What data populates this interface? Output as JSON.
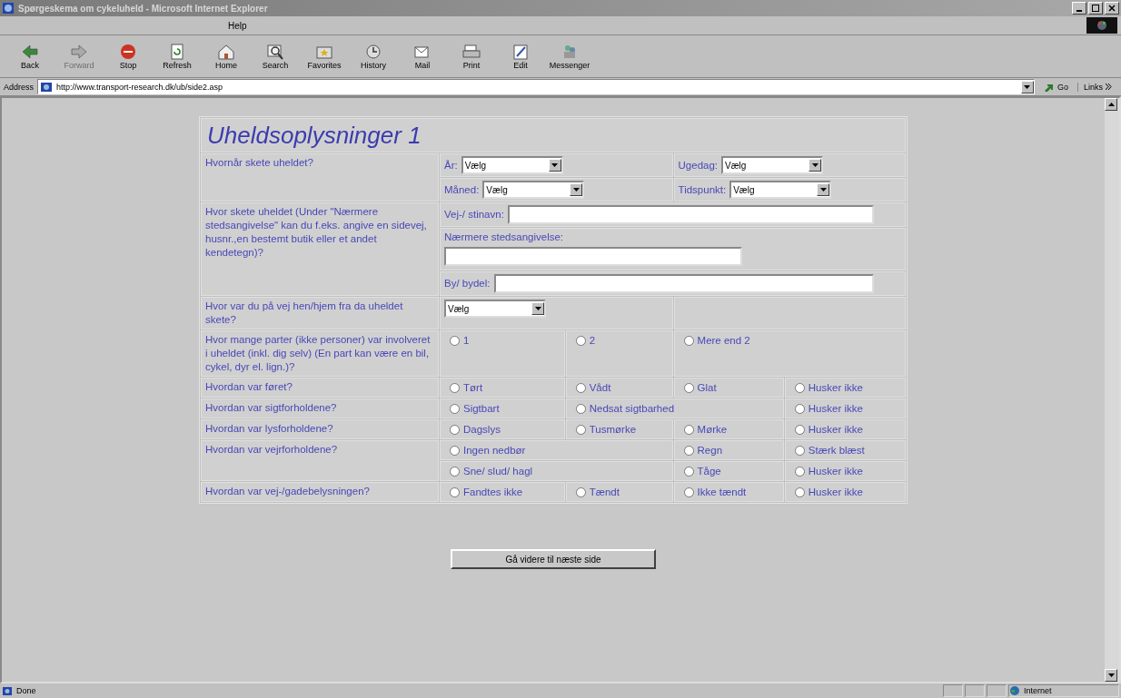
{
  "window": {
    "title": "Spørgeskema om cykeluheld - Microsoft Internet Explorer"
  },
  "menu": [
    "Help"
  ],
  "toolbar": [
    {
      "label": "Back",
      "disabled": false
    },
    {
      "label": "Forward",
      "disabled": true
    },
    {
      "label": "Stop",
      "disabled": false
    },
    {
      "label": "Refresh",
      "disabled": false
    },
    {
      "label": "Home",
      "disabled": false
    },
    {
      "label": "Search",
      "disabled": false
    },
    {
      "label": "Favorites",
      "disabled": false
    },
    {
      "label": "History",
      "disabled": false
    },
    {
      "label": "Mail",
      "disabled": false
    },
    {
      "label": "Print",
      "disabled": false
    },
    {
      "label": "Edit",
      "disabled": false
    },
    {
      "label": "Messenger",
      "disabled": false
    }
  ],
  "address_bar": {
    "label": "Address",
    "value": "http://www.transport-research.dk/ub/side2.asp",
    "go": "Go",
    "links": "Links"
  },
  "form": {
    "title": "Uheldsoplysninger 1",
    "rows": [
      {
        "question": "Hvornår skete uheldet?",
        "lines": [
          [
            {
              "kind": "select",
              "label": "År:",
              "value": "Vælg",
              "wide": true
            },
            {
              "kind": "select",
              "label": "Ugedag:",
              "value": "Vælg",
              "wide": true
            }
          ],
          [
            {
              "kind": "select",
              "label": "Måned:",
              "value": "Vælg",
              "wide": true
            },
            {
              "kind": "select",
              "label": "Tidspunkt:",
              "value": "Vælg",
              "wide": true
            }
          ]
        ]
      },
      {
        "question": "Hvor skete uheldet (Under \"Nærmere stedsangivelse\" kan du f.eks. angive en sidevej, husnr.,en bestemt butik eller et andet kendetegn)?",
        "lines": [
          [
            {
              "kind": "textfield",
              "label": "Vej-/ stinavn:",
              "stacked": false
            }
          ],
          [
            {
              "kind": "textfield",
              "label": "Nærmere stedsangivelse:",
              "stacked": true
            }
          ],
          [
            {
              "kind": "textfield",
              "label": "By/ bydel:",
              "stacked": false
            }
          ]
        ]
      },
      {
        "question": "Hvor var du på vej hen/hjem fra da uheldet skete?",
        "lines": [
          [
            {
              "kind": "select",
              "value": "Vælg",
              "wide": true
            },
            {
              "kind": "empty",
              "wide": true
            }
          ]
        ]
      },
      {
        "question": "Hvor mange parter (ikke personer) var involveret i uheldet (inkl. dig selv) (En part kan være en bil, cykel, dyr el. lign.)?",
        "lines": [
          [
            {
              "kind": "radio",
              "label": "1",
              "selected": false,
              "wide": false
            },
            {
              "kind": "radio",
              "label": "2",
              "selected": false,
              "wide": false
            },
            {
              "kind": "radio",
              "label": "Mere end 2",
              "selected": false,
              "wide": true
            }
          ]
        ]
      },
      {
        "question": "Hvordan var føret?",
        "lines": [
          [
            {
              "kind": "radio",
              "label": "Tørt",
              "selected": false,
              "wide": false
            },
            {
              "kind": "radio",
              "label": "Vådt",
              "selected": false,
              "wide": false
            },
            {
              "kind": "radio",
              "label": "Glat",
              "selected": false,
              "wide": false
            },
            {
              "kind": "radio",
              "label": "Husker ikke",
              "selected": false,
              "wide": false
            }
          ]
        ]
      },
      {
        "question": "Hvordan var sigtforholdene?",
        "lines": [
          [
            {
              "kind": "radio",
              "label": "Sigtbart",
              "selected": false,
              "wide": false
            },
            {
              "kind": "radio",
              "label": "Nedsat sigtbarhed",
              "selected": false,
              "wide": true
            },
            {
              "kind": "radio",
              "label": "Husker ikke",
              "selected": false,
              "wide": false
            }
          ]
        ]
      },
      {
        "question": "Hvordan var lysforholdene?",
        "lines": [
          [
            {
              "kind": "radio",
              "label": "Dagslys",
              "selected": false,
              "wide": false
            },
            {
              "kind": "radio",
              "label": "Tusmørke",
              "selected": false,
              "wide": false
            },
            {
              "kind": "radio",
              "label": "Mørke",
              "selected": false,
              "wide": false
            },
            {
              "kind": "radio",
              "label": "Husker ikke",
              "selected": false,
              "wide": false
            }
          ]
        ]
      },
      {
        "question": "Hvordan var vejrforholdene?",
        "lines": [
          [
            {
              "kind": "radio",
              "label": "Ingen nedbør",
              "selected": false,
              "wide": true
            },
            {
              "kind": "radio",
              "label": "Regn",
              "selected": false,
              "wide": false
            },
            {
              "kind": "radio",
              "label": "Stærk blæst",
              "selected": false,
              "wide": false
            }
          ],
          [
            {
              "kind": "radio",
              "label": "Sne/ slud/ hagl",
              "selected": false,
              "wide": true
            },
            {
              "kind": "radio",
              "label": "Tåge",
              "selected": false,
              "wide": false
            },
            {
              "kind": "radio",
              "label": "Husker ikke",
              "selected": false,
              "wide": false
            }
          ]
        ]
      },
      {
        "question": "Hvordan var vej-/gadebelysningen?",
        "lines": [
          [
            {
              "kind": "radio",
              "label": "Fandtes ikke",
              "selected": false,
              "wide": false
            },
            {
              "kind": "radio",
              "label": "Tændt",
              "selected": false,
              "wide": false
            },
            {
              "kind": "radio",
              "label": "Ikke tændt",
              "selected": false,
              "wide": false
            },
            {
              "kind": "radio",
              "label": "Husker ikke",
              "selected": false,
              "wide": false
            }
          ]
        ]
      }
    ],
    "submit": "Gå videre til næste side"
  },
  "status_bar": {
    "status": "Done",
    "zone": "Internet"
  }
}
